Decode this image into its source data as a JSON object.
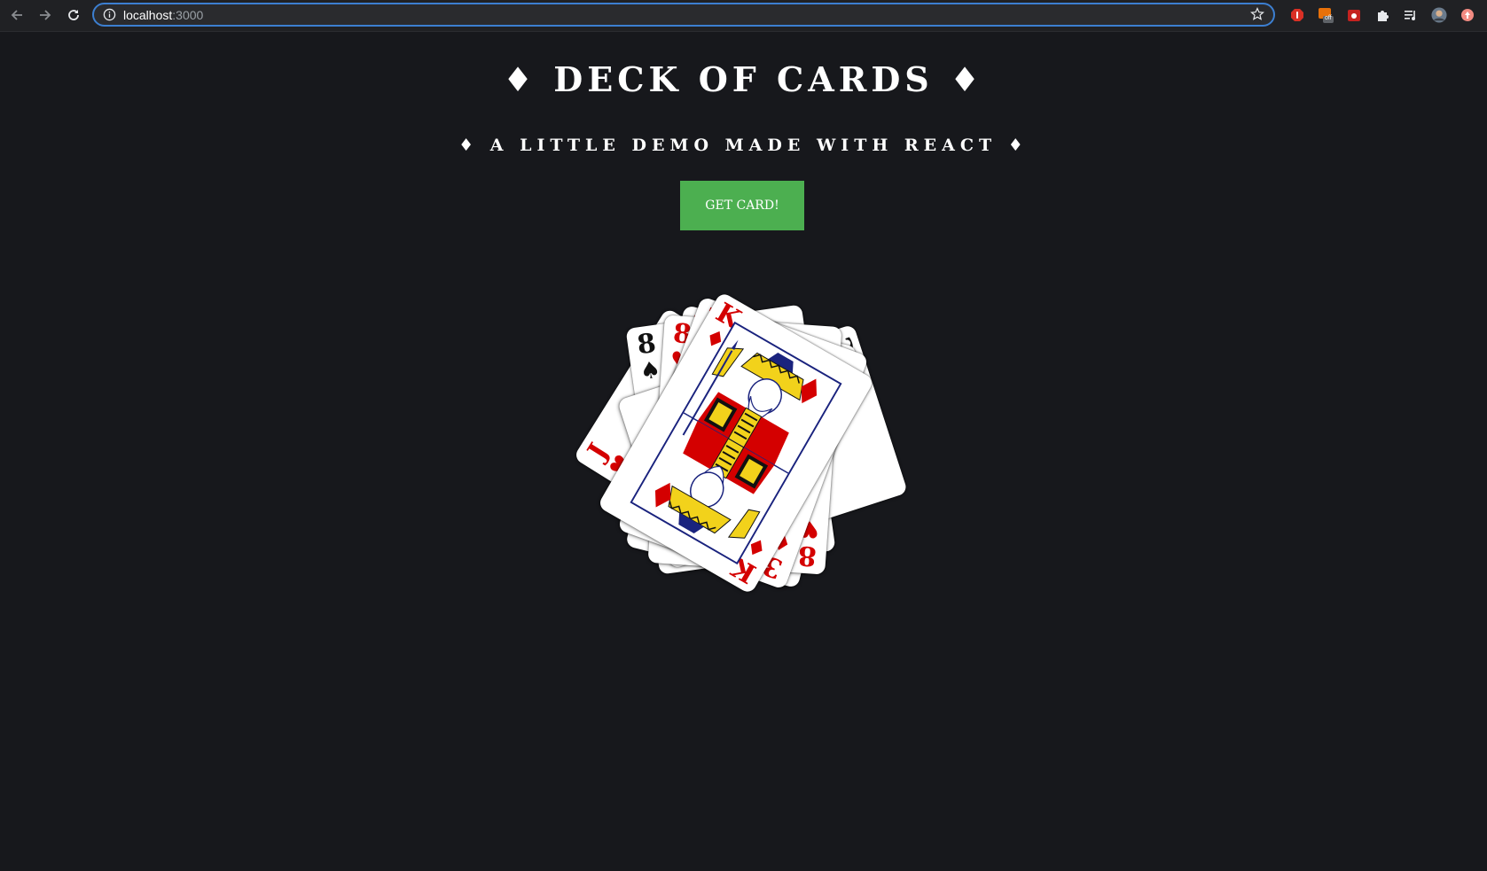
{
  "browser": {
    "url_host": "localhost",
    "url_port": ":3000",
    "extension_badge": "off"
  },
  "page": {
    "title": "♦ DECK OF CARDS ♦",
    "subtitle": "♦ A LITTLE DEMO MADE WITH REACT ♦",
    "button_label": "GET CARD!"
  },
  "cards": [
    {
      "rank": "J",
      "suit": "♥",
      "color": "red"
    },
    {
      "rank": "8",
      "suit": "♠",
      "color": "black"
    },
    {
      "rank": "2",
      "suit": "♣",
      "color": "black"
    },
    {
      "rank": "3",
      "suit": "♥",
      "color": "red"
    },
    {
      "rank": "8",
      "suit": "♥",
      "color": "red"
    },
    {
      "rank": "3",
      "suit": "♦",
      "color": "red"
    },
    {
      "rank": "K",
      "suit": "♦",
      "color": "red"
    }
  ],
  "colors": {
    "background": "#17181c",
    "button": "#4caf50",
    "suit_red": "#d40000"
  }
}
